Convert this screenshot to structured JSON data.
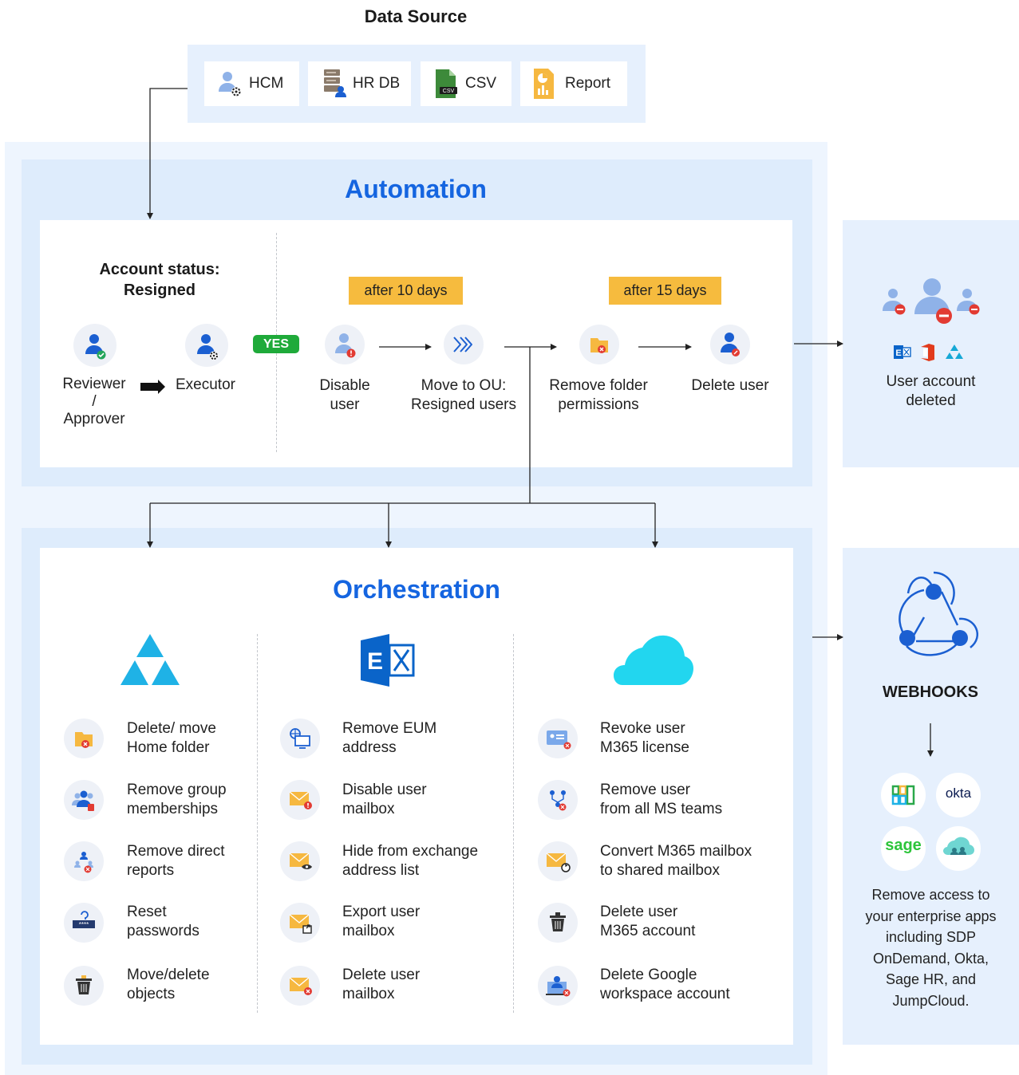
{
  "data_source": {
    "title": "Data Source",
    "items": [
      {
        "label": "HCM",
        "icon": "user-gear-icon"
      },
      {
        "label": "HR DB",
        "icon": "database-user-icon"
      },
      {
        "label": "CSV",
        "icon": "csv-file-icon"
      },
      {
        "label": "Report",
        "icon": "report-icon"
      }
    ]
  },
  "automation": {
    "title": "Automation",
    "account_status": "Account status:",
    "account_status_value": "Resigned",
    "reviewer_line1": "Reviewer",
    "reviewer_line2": "/",
    "reviewer_line3": "Approver",
    "executor": "Executor",
    "yes": "YES",
    "delay1": "after 10 days",
    "delay2": "after 15 days",
    "steps": [
      {
        "line1": "Disable",
        "line2": "user"
      },
      {
        "line1": "Move to OU:",
        "line2": "Resigned users"
      },
      {
        "line1": "Remove folder",
        "line2": "permissions"
      },
      {
        "line1": "Delete user",
        "line2": ""
      }
    ]
  },
  "result": {
    "line1": "User account",
    "line2": "deleted"
  },
  "orchestration": {
    "title": "Orchestration",
    "columns": [
      {
        "icon": "active-directory-icon",
        "items": [
          {
            "line1": "Delete/ move",
            "line2": "Home folder",
            "icon": "folder-remove-icon"
          },
          {
            "line1": "Remove group",
            "line2": "memberships",
            "icon": "group-remove-icon"
          },
          {
            "line1": "Remove direct",
            "line2": "reports",
            "icon": "org-chart-remove-icon"
          },
          {
            "line1": "Reset",
            "line2": "passwords",
            "icon": "password-icon"
          },
          {
            "line1": "Move/delete",
            "line2": "objects",
            "icon": "trash-icon"
          }
        ]
      },
      {
        "icon": "exchange-icon",
        "items": [
          {
            "line1": "Remove EUM",
            "line2": "address",
            "icon": "globe-monitor-icon"
          },
          {
            "line1": "Disable user",
            "line2": "mailbox",
            "icon": "mail-disable-icon"
          },
          {
            "line1": "Hide from exchange",
            "line2": "address list",
            "icon": "mail-hide-icon"
          },
          {
            "line1": "Export user",
            "line2": "mailbox",
            "icon": "mail-export-icon"
          },
          {
            "line1": "Delete user",
            "line2": "mailbox",
            "icon": "mail-delete-icon"
          }
        ]
      },
      {
        "icon": "cloud-icon",
        "items": [
          {
            "line1": "Revoke user",
            "line2": "M365 license",
            "icon": "license-revoke-icon"
          },
          {
            "line1": "Remove user",
            "line2": "from all MS teams",
            "icon": "teams-remove-icon"
          },
          {
            "line1": "Convert M365 mailbox",
            "line2": "to shared mailbox",
            "icon": "mail-convert-icon"
          },
          {
            "line1": "Delete user",
            "line2": "M365 account",
            "icon": "trash-icon"
          },
          {
            "line1": "Delete Google",
            "line2": "workspace account",
            "icon": "account-delete-icon"
          }
        ]
      }
    ]
  },
  "webhooks": {
    "title": "WEBHOOKS",
    "brands": [
      "okta",
      "sage"
    ],
    "description": [
      "Remove access to",
      "your enterprise apps",
      "including SDP",
      "OnDemand, Okta,",
      "Sage HR, and",
      "JumpCloud."
    ]
  },
  "colors": {
    "accent": "#1565e0",
    "pill": "#f6bb3e",
    "yes": "#1faa3a",
    "panel_outer": "#eef5fe",
    "panel_mid": "#deecfc"
  }
}
